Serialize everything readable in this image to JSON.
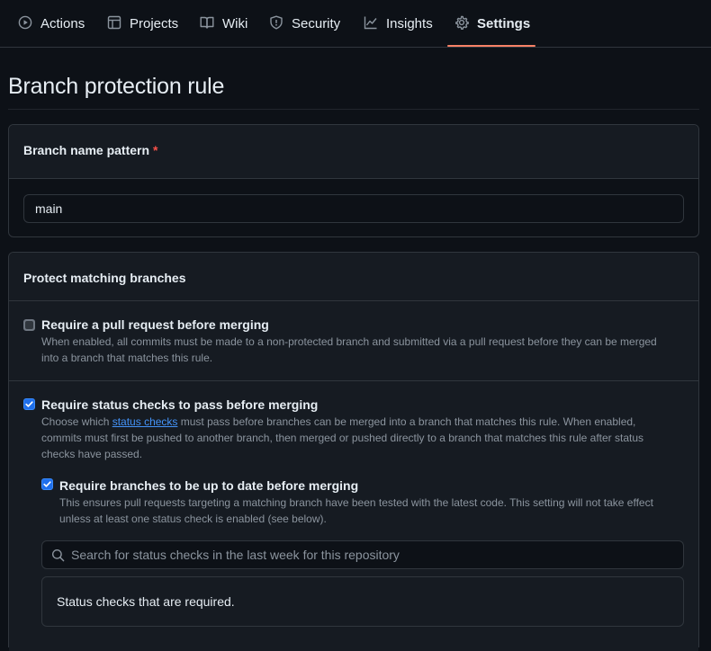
{
  "nav": {
    "tabs": [
      {
        "label": "Actions",
        "icon": "play-icon"
      },
      {
        "label": "Projects",
        "icon": "table-icon"
      },
      {
        "label": "Wiki",
        "icon": "book-icon"
      },
      {
        "label": "Security",
        "icon": "shield-icon"
      },
      {
        "label": "Insights",
        "icon": "graph-icon"
      },
      {
        "label": "Settings",
        "icon": "gear-icon",
        "selected": true
      }
    ]
  },
  "page": {
    "title": "Branch protection rule"
  },
  "branch_pattern": {
    "label": "Branch name pattern",
    "required_marker": "*",
    "value": "main"
  },
  "protect": {
    "header": "Protect matching branches",
    "options": [
      {
        "title": "Require a pull request before merging",
        "checked": false,
        "description": "When enabled, all commits must be made to a non-protected branch and submitted via a pull request before they can be merged into a branch that matches this rule."
      },
      {
        "title": "Require status checks to pass before merging",
        "checked": true,
        "description_pre": "Choose which ",
        "description_link": "status checks",
        "description_post": " must pass before branches can be merged into a branch that matches this rule. When enabled, commits must first be pushed to another branch, then merged or pushed directly to a branch that matches this rule after status checks have passed."
      }
    ],
    "sub_option": {
      "title": "Require branches to be up to date before merging",
      "checked": true,
      "description": "This ensures pull requests targeting a matching branch have been tested with the latest code. This setting will not take effect unless at least one status check is enabled (see below)."
    },
    "search": {
      "placeholder": "Search for status checks in the last week for this repository"
    },
    "required_checks_text": "Status checks that are required."
  },
  "colors": {
    "accent_underline": "#f78166",
    "link": "#4493f8",
    "checkbox_checked": "#1f6feb",
    "required_marker": "#f85149"
  }
}
